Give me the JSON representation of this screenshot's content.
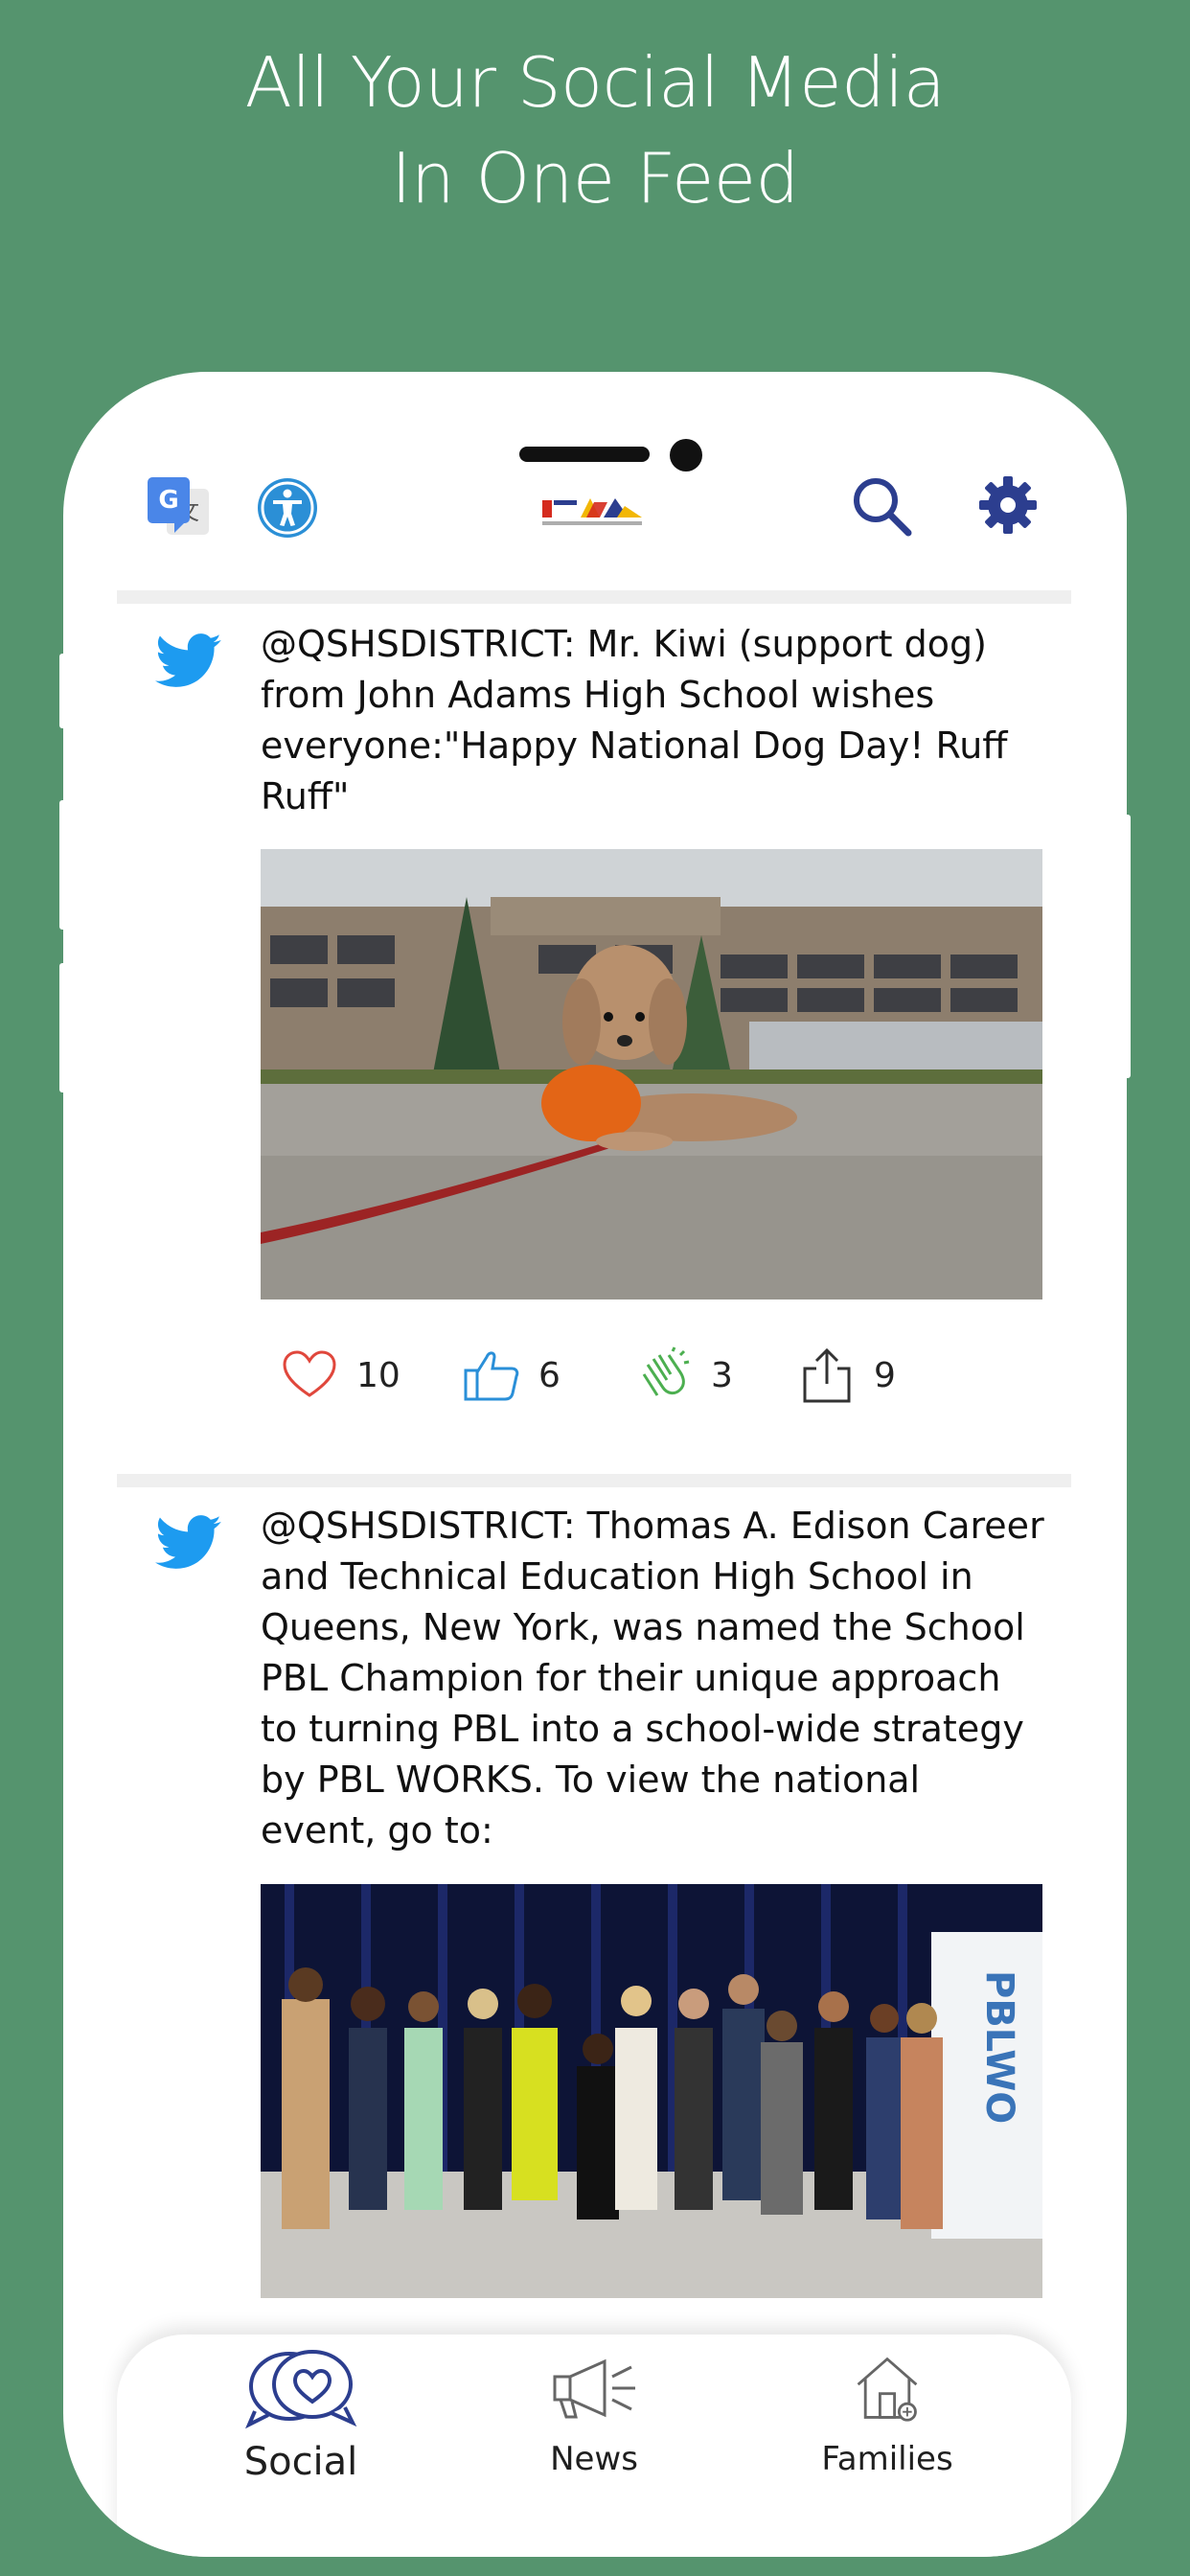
{
  "promo": {
    "title_line1": "All Your Social Media",
    "title_line2": "In One Feed"
  },
  "header": {
    "icons": [
      "translate-icon",
      "accessibility-icon",
      "logo",
      "search-icon",
      "gear-icon"
    ]
  },
  "feed": {
    "posts": [
      {
        "source": "twitter-icon",
        "text": "@QSHSDISTRICT: Mr. Kiwi (support dog) from John Adams High School wishes everyone:\"Happy National Dog Day! Ruff Ruff\"",
        "image_alt": "Small dog in orange vest lying on pavement in front of school building",
        "reactions": [
          {
            "icon": "heart-icon",
            "count": "10"
          },
          {
            "icon": "thumbs-up-icon",
            "count": "6"
          },
          {
            "icon": "clap-icon",
            "count": "3"
          },
          {
            "icon": "share-icon",
            "count": "9"
          }
        ]
      },
      {
        "source": "twitter-icon",
        "text": "@QSHSDISTRICT: Thomas A. Edison Career and Technical Education High School in Queens, New York, was named the School PBL Champion for their unique approach to turning PBL into a school-wide strategy by PBL WORKS. To view the national event, go to:",
        "image_alt": "Group photo of educators on stage",
        "banner_text": "PBLWO"
      }
    ]
  },
  "tabbar": {
    "tabs": [
      {
        "label": "Social",
        "icon": "chat-heart-icon",
        "selected": true
      },
      {
        "label": "News",
        "icon": "megaphone-icon",
        "selected": false
      },
      {
        "label": "Families",
        "icon": "house-icon",
        "selected": false
      }
    ]
  },
  "colors": {
    "background": "#55946e",
    "twitter": "#1d9bf0",
    "navy": "#2c3e8f",
    "heart": "#e0473c",
    "thumb": "#2a8fd8",
    "clap": "#4caf50"
  }
}
